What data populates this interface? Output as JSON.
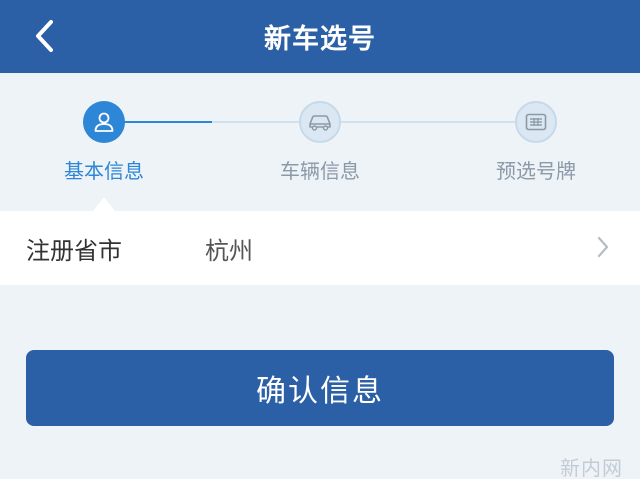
{
  "header": {
    "title": "新车选号",
    "back_icon": "chevron-left-icon"
  },
  "steps": [
    {
      "label": "基本信息",
      "icon": "user-icon",
      "state": "active"
    },
    {
      "label": "车辆信息",
      "icon": "car-icon",
      "state": "inactive"
    },
    {
      "label": "预选号牌",
      "icon": "license-plate-icon",
      "state": "inactive"
    }
  ],
  "form": {
    "registration": {
      "label": "注册省市",
      "value": "杭州"
    }
  },
  "actions": {
    "confirm_label": "确认信息"
  },
  "watermark": "新内网",
  "colors": {
    "primary": "#2b5fa6",
    "accent": "#2e86d6",
    "inactive_text": "#8a9aa8",
    "background": "#eef3f7"
  }
}
